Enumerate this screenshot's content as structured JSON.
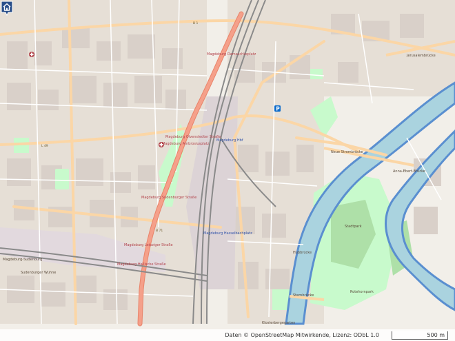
{
  "map": {
    "attribution": "Daten © OpenStreetMap Mitwirkende, Lizenz: ODbL 1.0",
    "scale_label": "500 m",
    "colors": {
      "land": "#f2efe9",
      "water": "#aad3df",
      "river_outline": "#5a8fd0",
      "park": "#c8facc",
      "primary_road": "#f5a08a",
      "secondary_road": "#fbd6a6",
      "railway": "#8a8a8a",
      "building": "#d9d0c9",
      "marker": "#2a4f8a"
    },
    "icons": [
      "home-marker-icon",
      "hospital-icon",
      "parking-icon"
    ],
    "labels": {
      "magdeburg_sudenburg": "Magdeburg-Sudenburg",
      "sudenburger_wuhne": "Sudenburger Wuhne",
      "b71": "B 71",
      "b1": "B 1",
      "l49": "L 49",
      "magdeburg_hbf": "Magdeburg Hbf",
      "hasselbachplatz": "Magdeburg Hasselbachplatz",
      "neue_strombrucke": "Neue Strombrücke",
      "anna_ebert_brucke": "Anna-Ebert-Brücke",
      "sternbrucke": "Sternbrücke",
      "hubbrucke": "Hubbrücke",
      "klosterbergegarten": "Klosterbergegarten",
      "rotehornpark": "Rotehornpark",
      "stadtpark": "Stadtpark",
      "jerusalembrucke": "Jerusalembrücke",
      "magdeburg_olvenstedter": "Magdeburg Olvenstedter Straße",
      "magdeburg_damaschkeplatz": "Magdeburg Damaschkeplatz",
      "magdeburg_ambrosiusplatz": "Magdeburg Ambrosiusplatz",
      "magdeburg_sudenburger_str": "Magdeburg Sudenburger Straße",
      "magdeburg_leipziger_str": "Magdeburg Leipziger Straße",
      "magdeburg_hellestrasse": "Magdeburg Hallische Straße"
    }
  }
}
